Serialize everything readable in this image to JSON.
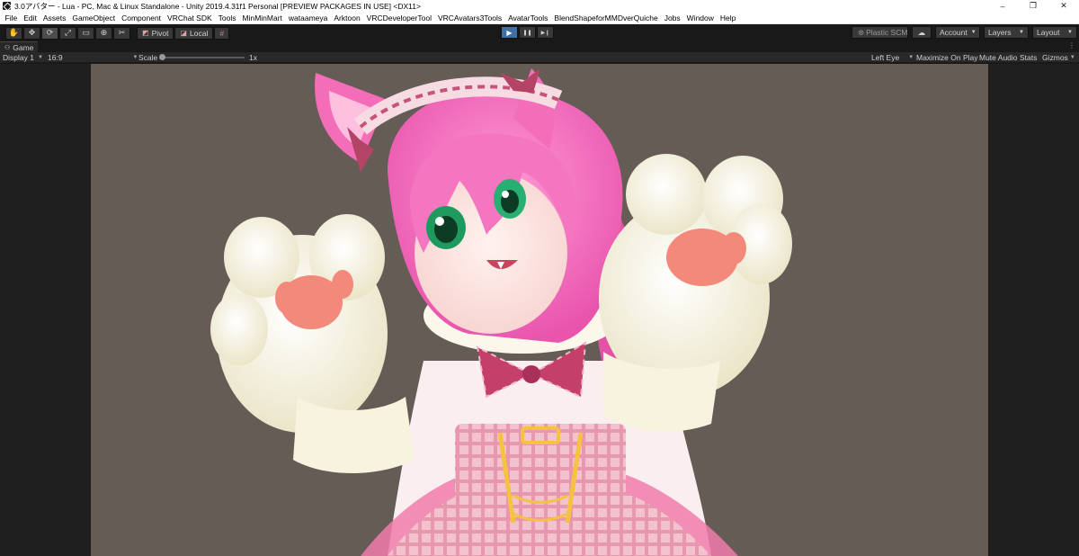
{
  "window": {
    "title": "3.0アバター - Lua - PC, Mac & Linux Standalone - Unity 2019.4.31f1 Personal [PREVIEW PACKAGES IN USE] <DX11>",
    "controls": [
      "–",
      "❐",
      "✕"
    ]
  },
  "menu": [
    "File",
    "Edit",
    "Assets",
    "GameObject",
    "Component",
    "VRChat SDK",
    "Tools",
    "MinMinMart",
    "wataameya",
    "Arktoon",
    "VRCDeveloperTool",
    "VRCAvatars3Tools",
    "AvatarTools",
    "BlendShapeforMMDverQuiche",
    "Jobs",
    "Window",
    "Help"
  ],
  "toolbar": {
    "tools": [
      "✋",
      "✥",
      "⟳",
      "⤢",
      "▭",
      "⊕",
      "✂"
    ],
    "active_tool_index": 2,
    "pivot_label": "Pivot",
    "local_label": "Local",
    "grid_icon": "#",
    "play": "▶",
    "pause": "❚❚",
    "step": "▶❙",
    "plastic_label": "Plastic SCM",
    "cloud_icon": "☁",
    "account_label": "Account",
    "layers_label": "Layers",
    "layout_label": "Layout"
  },
  "game_tab": {
    "label": "Game",
    "icon": "⚇",
    "menu_icon": "⋮"
  },
  "game_bar": {
    "display": "Display 1",
    "aspect": "16:9",
    "scale_label": "Scale",
    "scale_value": "1x",
    "eye": "Left Eye",
    "maximize": "Maximize On Play",
    "mute": "Mute Audio",
    "stats": "Stats",
    "gizmos": "Gizmos"
  },
  "colors": {
    "accent_play": "#3e6fa8",
    "scene_bg": "#655c56",
    "hair": "#f57bc4",
    "eye": "#27b071",
    "paw": "#f4f1d8",
    "pad": "#f3897a"
  }
}
